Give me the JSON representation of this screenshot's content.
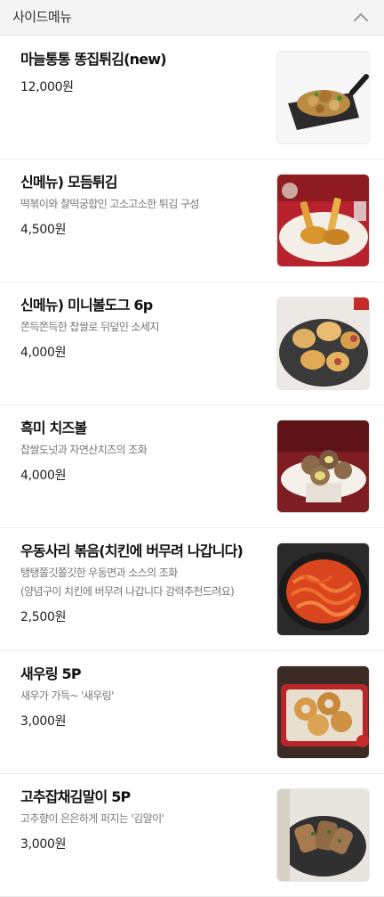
{
  "section": {
    "title": "사이드메뉴",
    "collapse_icon": "chevron-up-icon"
  },
  "items": [
    {
      "name": "마늘통통 똥집튀김(new)",
      "desc": "",
      "desc2": "",
      "price": "12,000원",
      "image": "gizzard-skillet"
    },
    {
      "name": "신메뉴) 모듬튀김",
      "desc": "떡볶이와 찰떡궁합인 고소고소한 튀김 구성",
      "desc2": "",
      "price": "4,500원",
      "image": "mixed-fries-plate"
    },
    {
      "name": "신메뉴) 미니볼도그 6p",
      "desc": "쫀득쫀득한 찹쌀로 뒤덮인 소세지",
      "desc2": "",
      "price": "4,000원",
      "image": "mini-ball-dogs"
    },
    {
      "name": "흑미 치즈볼",
      "desc": "찹쌀도넛과 자연산치즈의 조화",
      "desc2": "",
      "price": "4,000원",
      "image": "cheese-balls"
    },
    {
      "name": "우동사리 볶음(치킨에 버무려 나갑니다)",
      "desc": "탱탱쫄깃쫄깃한 우동면과 소스의 조화",
      "desc2": "(양념구이 치킨에 버무려 나갑니다 강력추천드려요)",
      "price": "2,500원",
      "image": "udon-stir-fry"
    },
    {
      "name": "새우링 5P",
      "desc": "새우가 가득~ '새우링'",
      "desc2": "",
      "price": "3,000원",
      "image": "shrimp-rings"
    },
    {
      "name": "고추잡채김말이 5P",
      "desc": "고추향이 은은하게 퍼지는 '김말이'",
      "desc2": "",
      "price": "3,000원",
      "image": "gimmari-rolls"
    }
  ]
}
